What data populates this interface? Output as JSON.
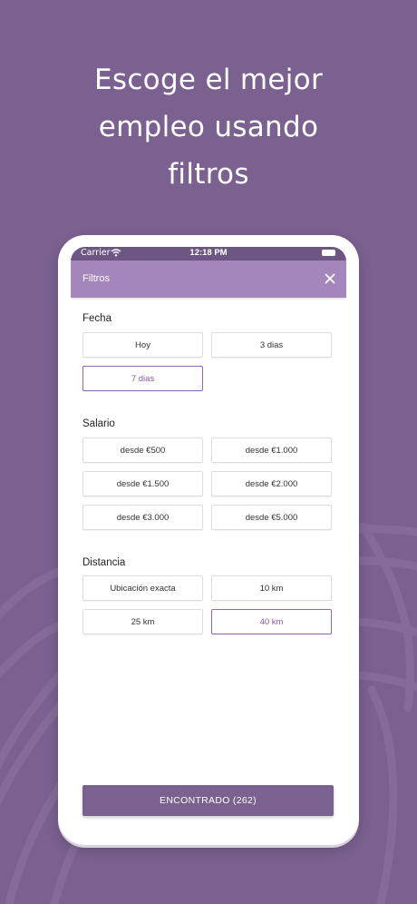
{
  "headline": {
    "line1": "Escoge el mejor",
    "line2": "empleo usando",
    "line3": "filtros"
  },
  "status_bar": {
    "carrier": "Carrier",
    "time": "12:18 PM",
    "wifi_icon": "wifi-icon",
    "battery_icon": "battery-icon"
  },
  "app_bar": {
    "title": "Filtros",
    "close_icon": "close-icon"
  },
  "fecha": {
    "title": "Fecha",
    "options": [
      "Hoy",
      "3 dias",
      "7 dias"
    ],
    "selected": "7 dias"
  },
  "salario": {
    "title": "Salario",
    "options": [
      "desde €500",
      "desde €1.000",
      "desde €1.500",
      "desde €2.000",
      "desde €3.000",
      "desde €5.000"
    ]
  },
  "distancia": {
    "title": "Distancia",
    "options": [
      "Ubicación exacta",
      "10 km",
      "25 km",
      "40 km"
    ],
    "selected": "40 km"
  },
  "cta": {
    "label": "ENCONTRADO (262)"
  },
  "colors": {
    "background": "#7a6190",
    "app_bar": "#a485bc",
    "accent": "#8c6aa8",
    "cta": "#7a6190"
  }
}
